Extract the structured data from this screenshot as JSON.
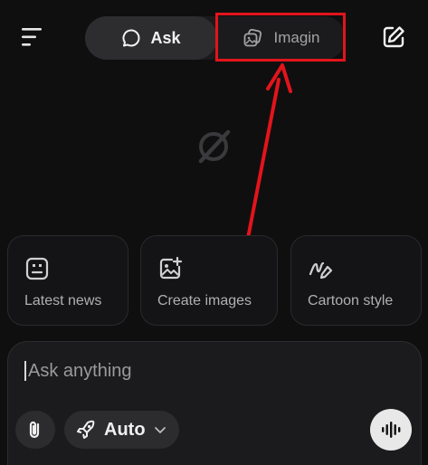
{
  "header": {
    "menu_icon": "menu-icon",
    "compose_icon": "compose-icon",
    "modes": [
      {
        "label": "Ask",
        "icon": "chat-bubble-icon",
        "active": true
      },
      {
        "label": "Imagin",
        "icon": "images-icon",
        "active": false
      }
    ]
  },
  "annotation": {
    "highlight_color": "#e3141b",
    "arrow_color": "#e3141b"
  },
  "suggestions": [
    {
      "label": "Latest news",
      "icon": "news-icon"
    },
    {
      "label": "Create images",
      "icon": "image-add-icon"
    },
    {
      "label": "Cartoon style",
      "icon": "draw-icon"
    }
  ],
  "composer": {
    "placeholder": "Ask anything",
    "model_label": "Auto",
    "attach_icon": "paperclip-icon",
    "model_icon": "rocket-icon",
    "voice_icon": "waveform-icon"
  },
  "colors": {
    "background": "#0f0f10",
    "panel": "#1b1b1d",
    "accent": "#e3141b"
  }
}
